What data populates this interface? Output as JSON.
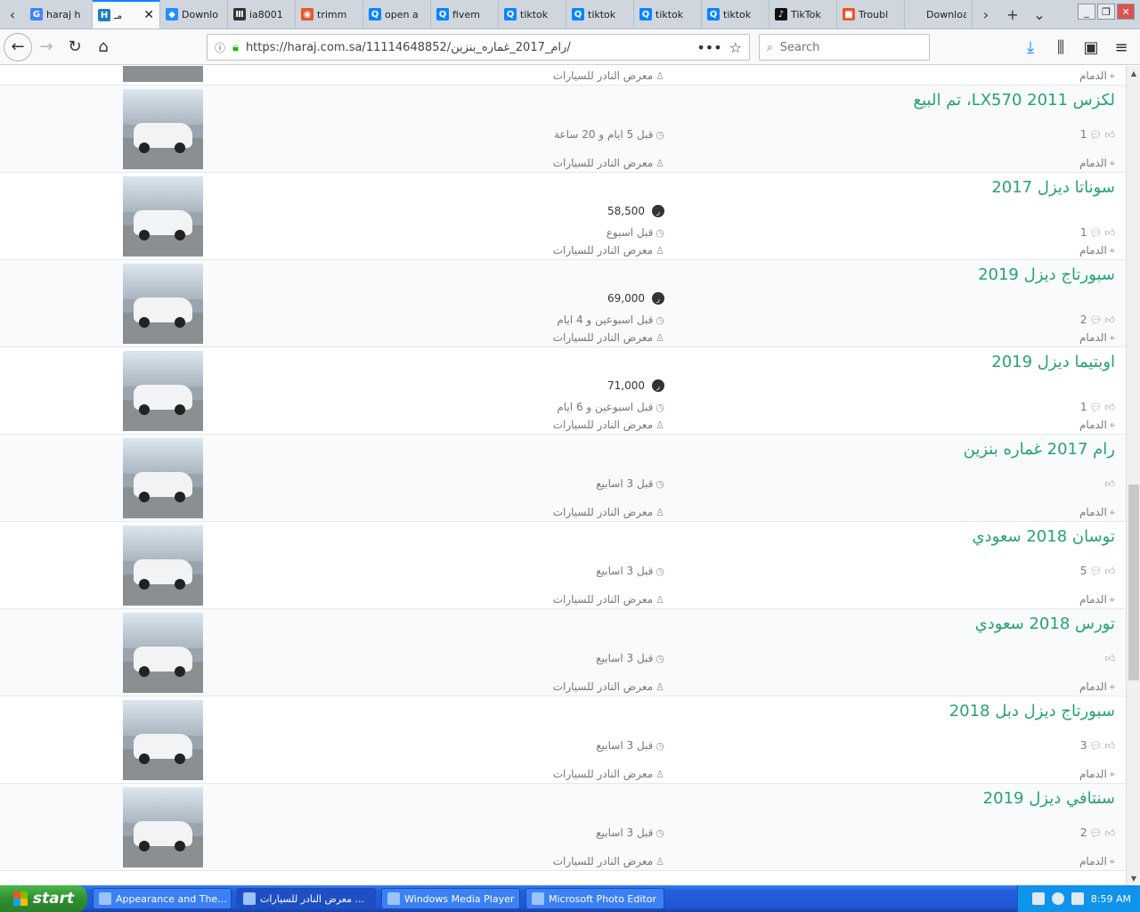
{
  "browser": {
    "tabs": [
      {
        "title": "haraj h",
        "favicon": "G",
        "color": "#4285f4"
      },
      {
        "title": "مـ",
        "favicon": "H",
        "color": "#1f7fbf",
        "active": true
      },
      {
        "title": "Downlo",
        "favicon": "◆",
        "color": "#1e90ff"
      },
      {
        "title": "ia8001",
        "favicon": "Ⅲ",
        "color": "#333333"
      },
      {
        "title": "trimm",
        "favicon": "◉",
        "color": "#e8562a"
      },
      {
        "title": "open a",
        "favicon": "Q",
        "color": "#0a84ff"
      },
      {
        "title": "fivem",
        "favicon": "Q",
        "color": "#0a84ff"
      },
      {
        "title": "tiktok",
        "favicon": "Q",
        "color": "#0a84ff"
      },
      {
        "title": "tiktok",
        "favicon": "Q",
        "color": "#0a84ff"
      },
      {
        "title": "tiktok",
        "favicon": "Q",
        "color": "#0a84ff"
      },
      {
        "title": "tiktok",
        "favicon": "Q",
        "color": "#0a84ff"
      },
      {
        "title": "TikTok",
        "favicon": "♪",
        "color": "#111111"
      },
      {
        "title": "Troubl",
        "favicon": "■",
        "color": "#f35325"
      },
      {
        "title": "Download",
        "favicon": "",
        "color": "#cfd6de"
      }
    ],
    "url": "https://haraj.com.sa/11114648852/رام_2017_غماره_بنزين/",
    "search_placeholder": "Search"
  },
  "listings": [
    {
      "title": "",
      "price": "",
      "time": "",
      "comments": "",
      "location": "الدمام",
      "seller": "معرض النادر للسيارات",
      "partial": true
    },
    {
      "title": "لكزس LX570 2011، تم البيع",
      "price": "",
      "time": "قبل 5 ايام و 20 ساعة",
      "comments": "1",
      "location": "الدمام",
      "seller": "معرض النادر للسيارات"
    },
    {
      "title": "سوناتا ديزل 2017",
      "price": "58,500",
      "time": "قبل اسبوع",
      "comments": "1",
      "location": "الدمام",
      "seller": "معرض النادر للسيارات"
    },
    {
      "title": "سبورتاج ديزل 2019",
      "price": "69,000",
      "time": "قبل اسبوعين و 4 ايام",
      "comments": "2",
      "location": "الدمام",
      "seller": "معرض النادر للسيارات"
    },
    {
      "title": "اوبتيما ديزل 2019",
      "price": "71,000",
      "time": "قبل اسبوعين و 6 ايام",
      "comments": "1",
      "location": "الدمام",
      "seller": "معرض النادر للسيارات"
    },
    {
      "title": "رام 2017 غماره بنزين",
      "price": "",
      "time": "قبل 3 اسابيع",
      "comments": "",
      "location": "الدمام",
      "seller": "معرض النادر للسيارات"
    },
    {
      "title": "توسان 2018 سعودي",
      "price": "",
      "time": "قبل 3 اسابيع",
      "comments": "5",
      "location": "الدمام",
      "seller": "معرض النادر للسيارات"
    },
    {
      "title": "تورس 2018 سعودي",
      "price": "",
      "time": "قبل 3 اسابيع",
      "comments": "",
      "location": "الدمام",
      "seller": "معرض النادر للسيارات"
    },
    {
      "title": "سبورتاج ديزل دبل 2018",
      "price": "",
      "time": "قبل 3 اسابيع",
      "comments": "3",
      "location": "الدمام",
      "seller": "معرض النادر للسيارات"
    },
    {
      "title": "سنتافي ديزل 2019",
      "price": "",
      "time": "قبل 3 اسابيع",
      "comments": "2",
      "location": "الدمام",
      "seller": "معرض النادر للسيارات"
    }
  ],
  "taskbar": {
    "start_label": "start",
    "tasks": [
      "Appearance and The...",
      "معرض النادر للسيارات ...",
      "Windows Media Player",
      "Microsoft Photo Editor"
    ],
    "clock": "8:59 AM"
  }
}
